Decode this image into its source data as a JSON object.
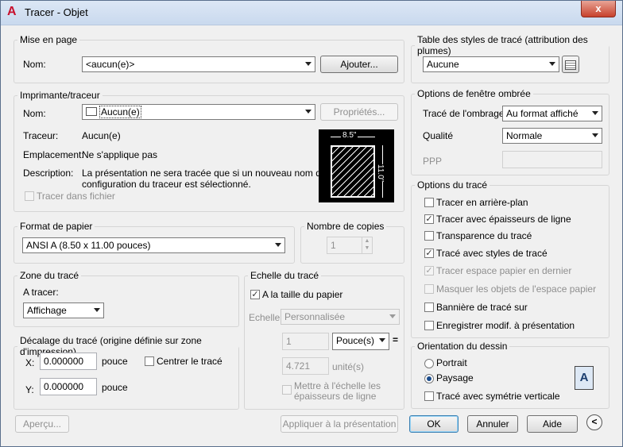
{
  "window": {
    "title": "Tracer - Objet",
    "close_glyph": "x",
    "logo_glyph": "A"
  },
  "mise_en_page": {
    "legend": "Mise en page",
    "nom_label": "Nom:",
    "nom_value": "<aucun(e)>",
    "ajouter": "Ajouter..."
  },
  "imprimante": {
    "legend": "Imprimante/traceur",
    "nom_label": "Nom:",
    "nom_value": "Aucun(e)",
    "proprietes": "Propriétés...",
    "traceur_label": "Traceur:",
    "traceur_value": "Aucun(e)",
    "emplacement_label": "Emplacement:",
    "emplacement_value": "Ne s'applique pas",
    "description_label": "Description:",
    "description_line1": "La présentation ne sera tracée que si un nouveau nom de",
    "description_line2": "configuration du traceur est sélectionné.",
    "tracer_fichier": "Tracer dans fichier",
    "preview_width": "8.5\"",
    "preview_height": "11.0\""
  },
  "format_papier": {
    "legend": "Format de papier",
    "value": "ANSI A (8.50 x 11.00 pouces)"
  },
  "copies": {
    "legend": "Nombre de copies",
    "value": "1"
  },
  "zone_trace": {
    "legend": "Zone du tracé",
    "a_tracer_label": "A tracer:",
    "value": "Affichage"
  },
  "decalage": {
    "legend": "Décalage du tracé (origine définie sur zone d'impression)",
    "x_label": "X:",
    "x_value": "0.000000",
    "x_unit": "pouce",
    "y_label": "Y:",
    "y_value": "0.000000",
    "y_unit": "pouce",
    "centrer": "Centrer le tracé"
  },
  "echelle": {
    "legend": "Echelle du tracé",
    "taille_papier": "A la taille du papier",
    "echelle_label": "Echelle:",
    "echelle_value": "Personnalisée",
    "val1": "1",
    "unit1": "Pouce(s)",
    "equals": "=",
    "val2": "4.721",
    "unit2": "unité(s)",
    "mettre_line1": "Mettre à l'échelle les",
    "mettre_line2": "épaisseurs de ligne"
  },
  "table_styles": {
    "legend": "Table des styles de tracé (attribution des plumes)",
    "value": "Aucune"
  },
  "fenetre_ombree": {
    "legend": "Options de fenêtre ombrée",
    "trace_ombrage_label": "Tracé de l'ombrage",
    "trace_ombrage_value": "Au format affiché",
    "qualite_label": "Qualité",
    "qualite_value": "Normale",
    "ppp_label": "PPP",
    "ppp_value": ""
  },
  "options_trace": {
    "legend": "Options du tracé",
    "items": [
      {
        "label": "Tracer en arrière-plan",
        "checked": false,
        "disabled": false
      },
      {
        "label": "Tracer avec épaisseurs de ligne",
        "checked": true,
        "disabled": false
      },
      {
        "label": "Transparence du tracé",
        "checked": false,
        "disabled": false
      },
      {
        "label": "Tracé avec styles de tracé",
        "checked": true,
        "disabled": false
      },
      {
        "label": "Tracer espace papier en dernier",
        "checked": true,
        "disabled": true
      },
      {
        "label": "Masquer les objets de l'espace papier",
        "checked": false,
        "disabled": true
      },
      {
        "label": "Bannière de tracé sur",
        "checked": false,
        "disabled": false
      },
      {
        "label": "Enregistrer modif. à présentation",
        "checked": false,
        "disabled": false
      }
    ]
  },
  "orientation": {
    "legend": "Orientation du dessin",
    "portrait": "Portrait",
    "paysage": "Paysage",
    "symetrie": "Tracé avec symétrie verticale",
    "icon_letter": "A"
  },
  "footer": {
    "apercu": "Aperçu...",
    "appliquer": "Appliquer à la présentation",
    "ok": "OK",
    "annuler": "Annuler",
    "aide": "Aide"
  },
  "check_mark": "✓"
}
